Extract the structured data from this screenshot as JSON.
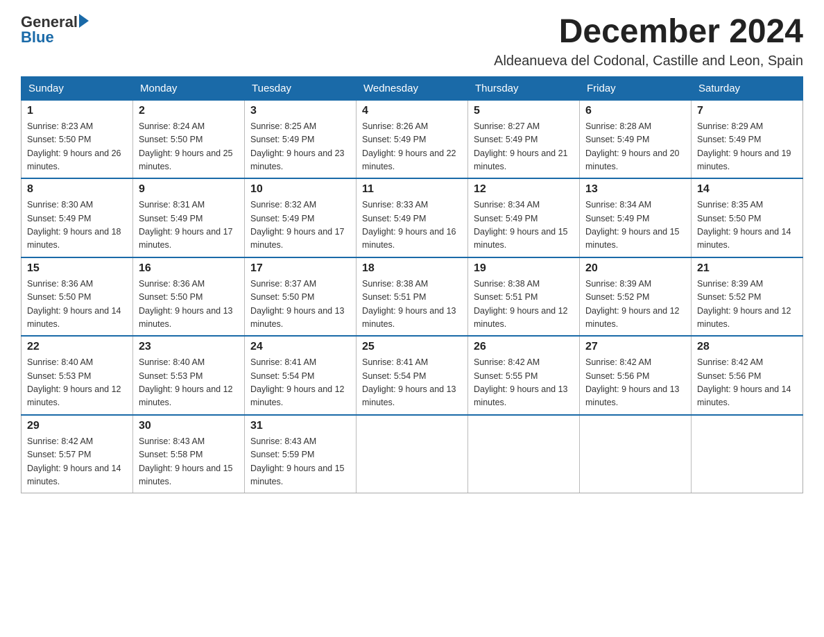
{
  "header": {
    "logo_general": "General",
    "logo_blue": "Blue",
    "month_title": "December 2024",
    "subtitle": "Aldeanueva del Codonal, Castille and Leon, Spain"
  },
  "weekdays": [
    "Sunday",
    "Monday",
    "Tuesday",
    "Wednesday",
    "Thursday",
    "Friday",
    "Saturday"
  ],
  "weeks": [
    [
      {
        "day": "1",
        "sunrise": "8:23 AM",
        "sunset": "5:50 PM",
        "daylight": "9 hours and 26 minutes."
      },
      {
        "day": "2",
        "sunrise": "8:24 AM",
        "sunset": "5:50 PM",
        "daylight": "9 hours and 25 minutes."
      },
      {
        "day": "3",
        "sunrise": "8:25 AM",
        "sunset": "5:49 PM",
        "daylight": "9 hours and 23 minutes."
      },
      {
        "day": "4",
        "sunrise": "8:26 AM",
        "sunset": "5:49 PM",
        "daylight": "9 hours and 22 minutes."
      },
      {
        "day": "5",
        "sunrise": "8:27 AM",
        "sunset": "5:49 PM",
        "daylight": "9 hours and 21 minutes."
      },
      {
        "day": "6",
        "sunrise": "8:28 AM",
        "sunset": "5:49 PM",
        "daylight": "9 hours and 20 minutes."
      },
      {
        "day": "7",
        "sunrise": "8:29 AM",
        "sunset": "5:49 PM",
        "daylight": "9 hours and 19 minutes."
      }
    ],
    [
      {
        "day": "8",
        "sunrise": "8:30 AM",
        "sunset": "5:49 PM",
        "daylight": "9 hours and 18 minutes."
      },
      {
        "day": "9",
        "sunrise": "8:31 AM",
        "sunset": "5:49 PM",
        "daylight": "9 hours and 17 minutes."
      },
      {
        "day": "10",
        "sunrise": "8:32 AM",
        "sunset": "5:49 PM",
        "daylight": "9 hours and 17 minutes."
      },
      {
        "day": "11",
        "sunrise": "8:33 AM",
        "sunset": "5:49 PM",
        "daylight": "9 hours and 16 minutes."
      },
      {
        "day": "12",
        "sunrise": "8:34 AM",
        "sunset": "5:49 PM",
        "daylight": "9 hours and 15 minutes."
      },
      {
        "day": "13",
        "sunrise": "8:34 AM",
        "sunset": "5:49 PM",
        "daylight": "9 hours and 15 minutes."
      },
      {
        "day": "14",
        "sunrise": "8:35 AM",
        "sunset": "5:50 PM",
        "daylight": "9 hours and 14 minutes."
      }
    ],
    [
      {
        "day": "15",
        "sunrise": "8:36 AM",
        "sunset": "5:50 PM",
        "daylight": "9 hours and 14 minutes."
      },
      {
        "day": "16",
        "sunrise": "8:36 AM",
        "sunset": "5:50 PM",
        "daylight": "9 hours and 13 minutes."
      },
      {
        "day": "17",
        "sunrise": "8:37 AM",
        "sunset": "5:50 PM",
        "daylight": "9 hours and 13 minutes."
      },
      {
        "day": "18",
        "sunrise": "8:38 AM",
        "sunset": "5:51 PM",
        "daylight": "9 hours and 13 minutes."
      },
      {
        "day": "19",
        "sunrise": "8:38 AM",
        "sunset": "5:51 PM",
        "daylight": "9 hours and 12 minutes."
      },
      {
        "day": "20",
        "sunrise": "8:39 AM",
        "sunset": "5:52 PM",
        "daylight": "9 hours and 12 minutes."
      },
      {
        "day": "21",
        "sunrise": "8:39 AM",
        "sunset": "5:52 PM",
        "daylight": "9 hours and 12 minutes."
      }
    ],
    [
      {
        "day": "22",
        "sunrise": "8:40 AM",
        "sunset": "5:53 PM",
        "daylight": "9 hours and 12 minutes."
      },
      {
        "day": "23",
        "sunrise": "8:40 AM",
        "sunset": "5:53 PM",
        "daylight": "9 hours and 12 minutes."
      },
      {
        "day": "24",
        "sunrise": "8:41 AM",
        "sunset": "5:54 PM",
        "daylight": "9 hours and 12 minutes."
      },
      {
        "day": "25",
        "sunrise": "8:41 AM",
        "sunset": "5:54 PM",
        "daylight": "9 hours and 13 minutes."
      },
      {
        "day": "26",
        "sunrise": "8:42 AM",
        "sunset": "5:55 PM",
        "daylight": "9 hours and 13 minutes."
      },
      {
        "day": "27",
        "sunrise": "8:42 AM",
        "sunset": "5:56 PM",
        "daylight": "9 hours and 13 minutes."
      },
      {
        "day": "28",
        "sunrise": "8:42 AM",
        "sunset": "5:56 PM",
        "daylight": "9 hours and 14 minutes."
      }
    ],
    [
      {
        "day": "29",
        "sunrise": "8:42 AM",
        "sunset": "5:57 PM",
        "daylight": "9 hours and 14 minutes."
      },
      {
        "day": "30",
        "sunrise": "8:43 AM",
        "sunset": "5:58 PM",
        "daylight": "9 hours and 15 minutes."
      },
      {
        "day": "31",
        "sunrise": "8:43 AM",
        "sunset": "5:59 PM",
        "daylight": "9 hours and 15 minutes."
      },
      null,
      null,
      null,
      null
    ]
  ]
}
